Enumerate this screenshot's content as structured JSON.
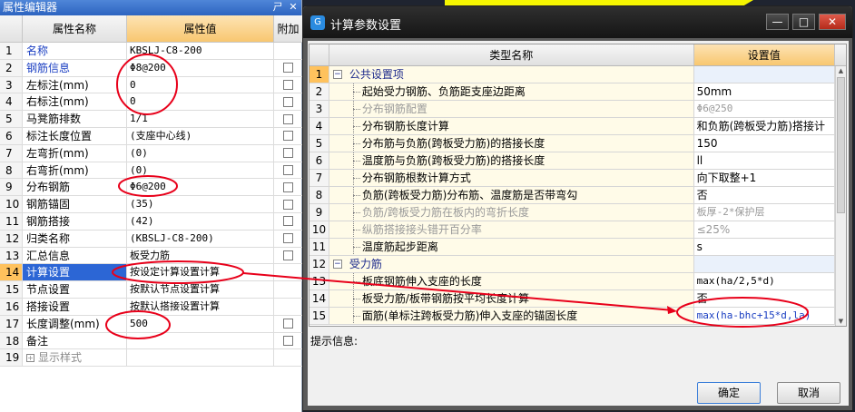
{
  "left_panel": {
    "title": "属性编辑器",
    "pin_glyph": "ㄕ",
    "close_glyph": "✕",
    "columns": {
      "name": "属性名称",
      "value": "属性值",
      "add": "附加"
    },
    "rows": [
      {
        "num": "1",
        "name": "名称",
        "value": "KBSLJ-C8-200",
        "checkbox": false,
        "style": "blue"
      },
      {
        "num": "2",
        "name": "钢筋信息",
        "value": "Φ8@200",
        "checkbox": true,
        "style": "blue"
      },
      {
        "num": "3",
        "name": "左标注(mm)",
        "value": "0",
        "checkbox": true,
        "style": ""
      },
      {
        "num": "4",
        "name": "右标注(mm)",
        "value": "0",
        "checkbox": true,
        "style": ""
      },
      {
        "num": "5",
        "name": "马凳筋排数",
        "value": "1/1",
        "checkbox": true,
        "style": ""
      },
      {
        "num": "6",
        "name": "标注长度位置",
        "value": "(支座中心线)",
        "checkbox": true,
        "style": ""
      },
      {
        "num": "7",
        "name": "左弯折(mm)",
        "value": "(0)",
        "checkbox": true,
        "style": ""
      },
      {
        "num": "8",
        "name": "右弯折(mm)",
        "value": "(0)",
        "checkbox": true,
        "style": ""
      },
      {
        "num": "9",
        "name": "分布钢筋",
        "value": "Φ6@200",
        "checkbox": true,
        "style": ""
      },
      {
        "num": "10",
        "name": "钢筋锚固",
        "value": "(35)",
        "checkbox": true,
        "style": ""
      },
      {
        "num": "11",
        "name": "钢筋搭接",
        "value": "(42)",
        "checkbox": true,
        "style": ""
      },
      {
        "num": "12",
        "name": "归类名称",
        "value": "(KBSLJ-C8-200)",
        "checkbox": true,
        "style": ""
      },
      {
        "num": "13",
        "name": "汇总信息",
        "value": "板受力筋",
        "checkbox": true,
        "style": ""
      },
      {
        "num": "14",
        "name": "计算设置",
        "value": "按设定计算设置计算",
        "checkbox": false,
        "style": "sel"
      },
      {
        "num": "15",
        "name": "节点设置",
        "value": "按默认节点设置计算",
        "checkbox": false,
        "style": ""
      },
      {
        "num": "16",
        "name": "搭接设置",
        "value": "按默认搭接设置计算",
        "checkbox": false,
        "style": ""
      },
      {
        "num": "17",
        "name": "长度调整(mm)",
        "value": "500",
        "checkbox": true,
        "style": ""
      },
      {
        "num": "18",
        "name": "备注",
        "value": "",
        "checkbox": true,
        "style": ""
      },
      {
        "num": "19",
        "name": "显示样式",
        "value": "",
        "checkbox": false,
        "style": "disabled",
        "expand": "+"
      }
    ]
  },
  "dialog": {
    "title": "计算参数设置",
    "logo_glyph": "G",
    "min_glyph": "—",
    "max_glyph": "□",
    "close_glyph": "✕",
    "columns": {
      "name": "类型名称",
      "value": "设置值"
    },
    "rows": [
      {
        "num": "1",
        "name": "公共设置项",
        "value": "",
        "type": "section",
        "toggle": "−"
      },
      {
        "num": "2",
        "name": "起始受力钢筋、负筋距支座边距离",
        "value": "50mm",
        "type": ""
      },
      {
        "num": "3",
        "name": "分布钢筋配置",
        "value": "Φ6@250",
        "type": "disabled"
      },
      {
        "num": "4",
        "name": "分布钢筋长度计算",
        "value": "和负筋(跨板受力筋)搭接计",
        "type": ""
      },
      {
        "num": "5",
        "name": "分布筋与负筋(跨板受力筋)的搭接长度",
        "value": "150",
        "type": ""
      },
      {
        "num": "6",
        "name": "温度筋与负筋(跨板受力筋)的搭接长度",
        "value": "ll",
        "type": ""
      },
      {
        "num": "7",
        "name": "分布钢筋根数计算方式",
        "value": "向下取整+1",
        "type": ""
      },
      {
        "num": "8",
        "name": "负筋(跨板受力筋)分布筋、温度筋是否带弯勾",
        "value": "否",
        "type": ""
      },
      {
        "num": "9",
        "name": "负筋/跨板受力筋在板内的弯折长度",
        "value": "板厚-2*保护层",
        "type": "disabled"
      },
      {
        "num": "10",
        "name": "纵筋搭接接头错开百分率",
        "value": "≤25%",
        "type": "disabled"
      },
      {
        "num": "11",
        "name": "温度筋起步距离",
        "value": "s",
        "type": ""
      },
      {
        "num": "12",
        "name": "受力筋",
        "value": "",
        "type": "section",
        "toggle": "−"
      },
      {
        "num": "13",
        "name": "板底钢筋伸入支座的长度",
        "value": "max(ha/2,5*d)",
        "type": ""
      },
      {
        "num": "14",
        "name": "板受力筋/板带钢筋按平均长度计算",
        "value": "否",
        "type": ""
      },
      {
        "num": "15",
        "name": "面筋(单标注跨板受力筋)伸入支座的锚固长度",
        "value": "max(ha-bhc+15*d,la)",
        "type": ""
      }
    ],
    "scroll_up_glyph": "▲",
    "scroll_down_glyph": "▼",
    "hint_label": "提示信息:",
    "ok_label": "确定",
    "cancel_label": "取消"
  },
  "colors": {
    "annotation_red": "#e8001a",
    "selected_blue": "#2c66d5",
    "header_orange": "#f8c770"
  }
}
